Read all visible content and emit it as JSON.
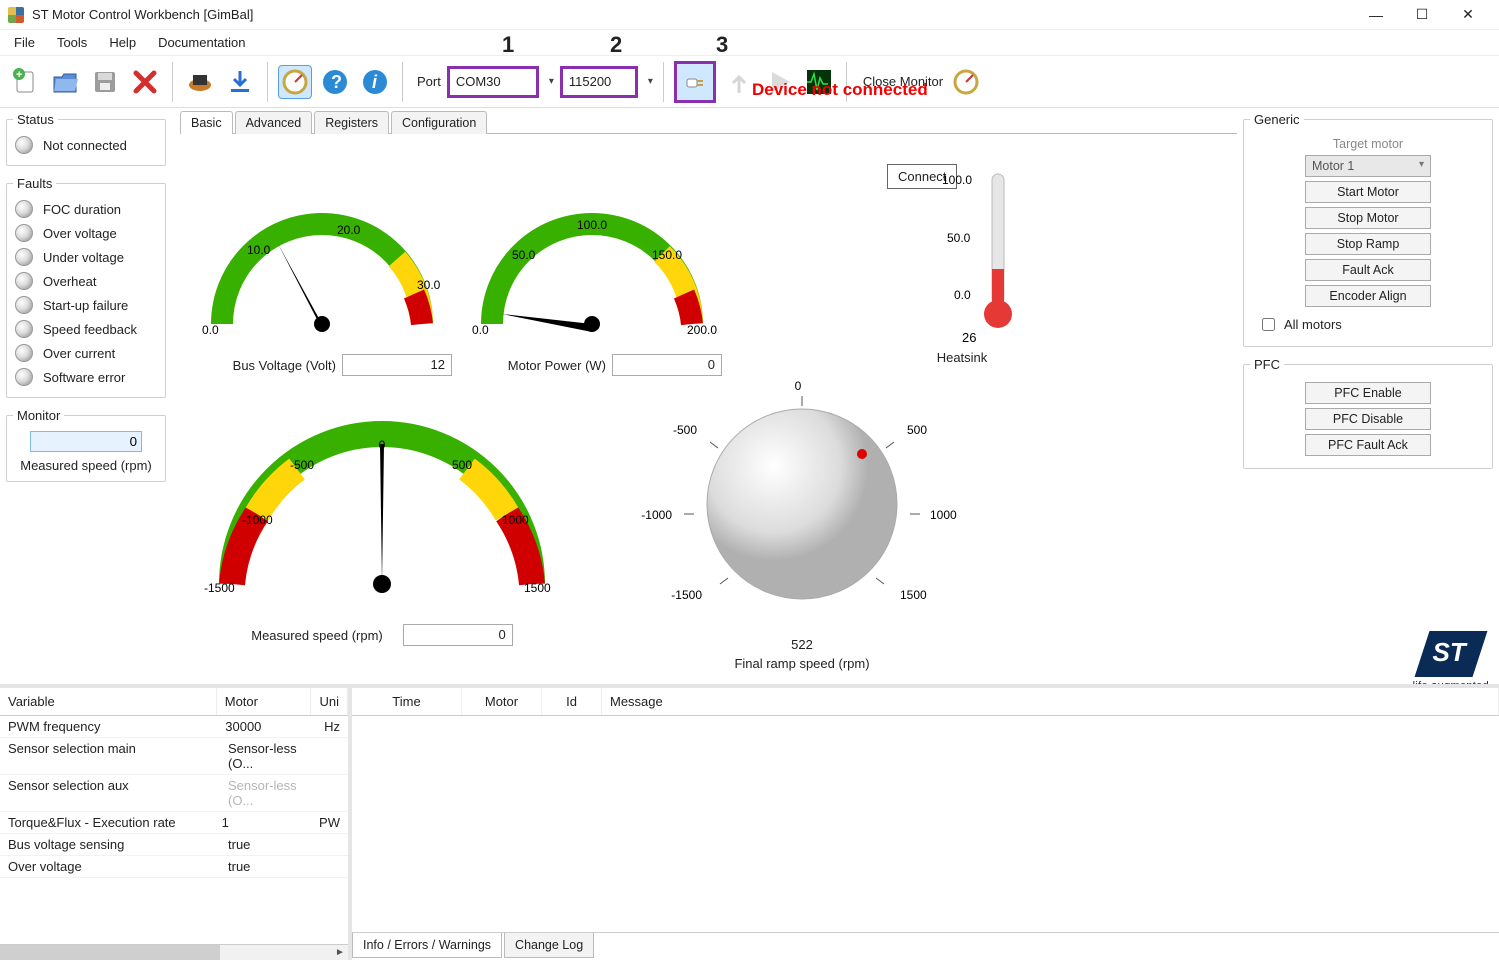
{
  "window": {
    "title": "ST Motor Control Workbench [GimBal]"
  },
  "menu": {
    "file": "File",
    "tools": "Tools",
    "help": "Help",
    "documentation": "Documentation"
  },
  "toolbar": {
    "port_label": "Port",
    "port_value": "COM30",
    "baud_value": "115200",
    "close_monitor": "Close Monitor",
    "annot1": "1",
    "annot2": "2",
    "annot3": "3"
  },
  "status_bar_text": "Device not connected",
  "connect_tooltip": "Connect",
  "tabs": {
    "basic": "Basic",
    "advanced": "Advanced",
    "registers": "Registers",
    "configuration": "Configuration"
  },
  "status_panel": {
    "legend": "Status",
    "not_connected_label": "Not connected"
  },
  "faults_panel": {
    "legend": "Faults",
    "items": [
      "FOC duration",
      "Over voltage",
      "Under voltage",
      "Overheat",
      "Start-up failure",
      "Speed feedback",
      "Over current",
      "Software error"
    ]
  },
  "monitor_panel": {
    "legend": "Monitor",
    "value": "0",
    "label": "Measured speed (rpm)"
  },
  "gauges": {
    "bus_voltage": {
      "label": "Bus Voltage (Volt)",
      "value": "12",
      "ticks": [
        "0.0",
        "10.0",
        "20.0",
        "30.0"
      ]
    },
    "motor_power": {
      "label": "Motor Power (W)",
      "value": "0",
      "ticks": [
        "0.0",
        "50.0",
        "100.0",
        "150.0",
        "200.0"
      ]
    },
    "heatsink": {
      "label": "Heatsink",
      "value": "26",
      "ticks": [
        "0.0",
        "50.0",
        "100.0"
      ]
    },
    "measured_speed": {
      "label": "Measured speed (rpm)",
      "value": "0",
      "ticks": [
        "-1500",
        "-1000",
        "-500",
        "0",
        "500",
        "1000",
        "1500"
      ]
    },
    "final_ramp": {
      "label": "Final ramp speed (rpm)",
      "value": "522",
      "ticks": [
        "-1500",
        "-1000",
        "-500",
        "0",
        "500",
        "1000",
        "1500"
      ]
    }
  },
  "generic_panel": {
    "legend": "Generic",
    "target_motor_label": "Target motor",
    "motor_select": "Motor 1",
    "start_motor": "Start Motor",
    "stop_motor": "Stop Motor",
    "stop_ramp": "Stop Ramp",
    "fault_ack": "Fault Ack",
    "encoder_align": "Encoder Align",
    "all_motors": "All motors"
  },
  "pfc_panel": {
    "legend": "PFC",
    "enable": "PFC Enable",
    "disable": "PFC Disable",
    "fault_ack": "PFC Fault Ack"
  },
  "st_logo_tagline": "life.augmented",
  "vars_table": {
    "headers": [
      "Variable",
      "Motor",
      "Uni"
    ],
    "rows": [
      {
        "v": "PWM frequency",
        "m": "30000",
        "u": "Hz"
      },
      {
        "v": "Sensor selection main",
        "m": "Sensor-less (O...",
        "u": ""
      },
      {
        "v": "Sensor selection aux",
        "m": "Sensor-less (O...",
        "u": "",
        "muted": true
      },
      {
        "v": "Torque&Flux - Execution rate",
        "m": "1",
        "u": "PW"
      },
      {
        "v": "Bus voltage sensing",
        "m": "true",
        "u": ""
      },
      {
        "v": "Over voltage",
        "m": "true",
        "u": ""
      }
    ]
  },
  "log_table": {
    "headers": [
      "Time",
      "Motor",
      "Id",
      "Message"
    ],
    "tabs": {
      "info": "Info / Errors / Warnings",
      "changelog": "Change Log"
    }
  }
}
